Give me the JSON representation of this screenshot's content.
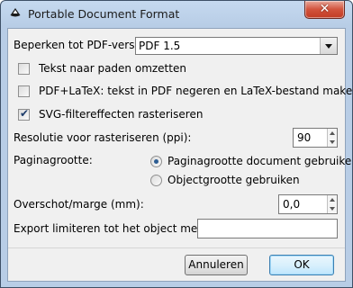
{
  "window": {
    "title": "Portable Document Format",
    "close_symbol": "✕"
  },
  "pdf_version": {
    "label": "Beperken tot PDF-versie:",
    "selected": "PDF 1.5"
  },
  "checkboxes": [
    {
      "label": "Tekst naar paden omzetten",
      "checked": false
    },
    {
      "label": "PDF+LaTeX: tekst in PDF negeren en LaTeX-bestand maken",
      "checked": false
    },
    {
      "label": "SVG-filtereffecten rasteriseren",
      "checked": true
    }
  ],
  "resolution": {
    "label": "Resolutie voor rasteriseren (ppi):",
    "value": "90"
  },
  "page_size": {
    "label": "Paginagrootte:",
    "options": [
      {
        "label": "Paginagrootte document gebruiken",
        "selected": true
      },
      {
        "label": "Objectgrootte gebruiken",
        "selected": false
      }
    ]
  },
  "margin": {
    "label": "Overschot/marge (mm):",
    "value": "0,0"
  },
  "export_id": {
    "label": "Export limiteren tot het object met ID:",
    "value": ""
  },
  "buttons": {
    "cancel": "Annuleren",
    "ok": "OK"
  },
  "icons": {
    "app": "inkscape-icon",
    "close": "close-icon",
    "dropdown": "chevron-down-icon"
  }
}
